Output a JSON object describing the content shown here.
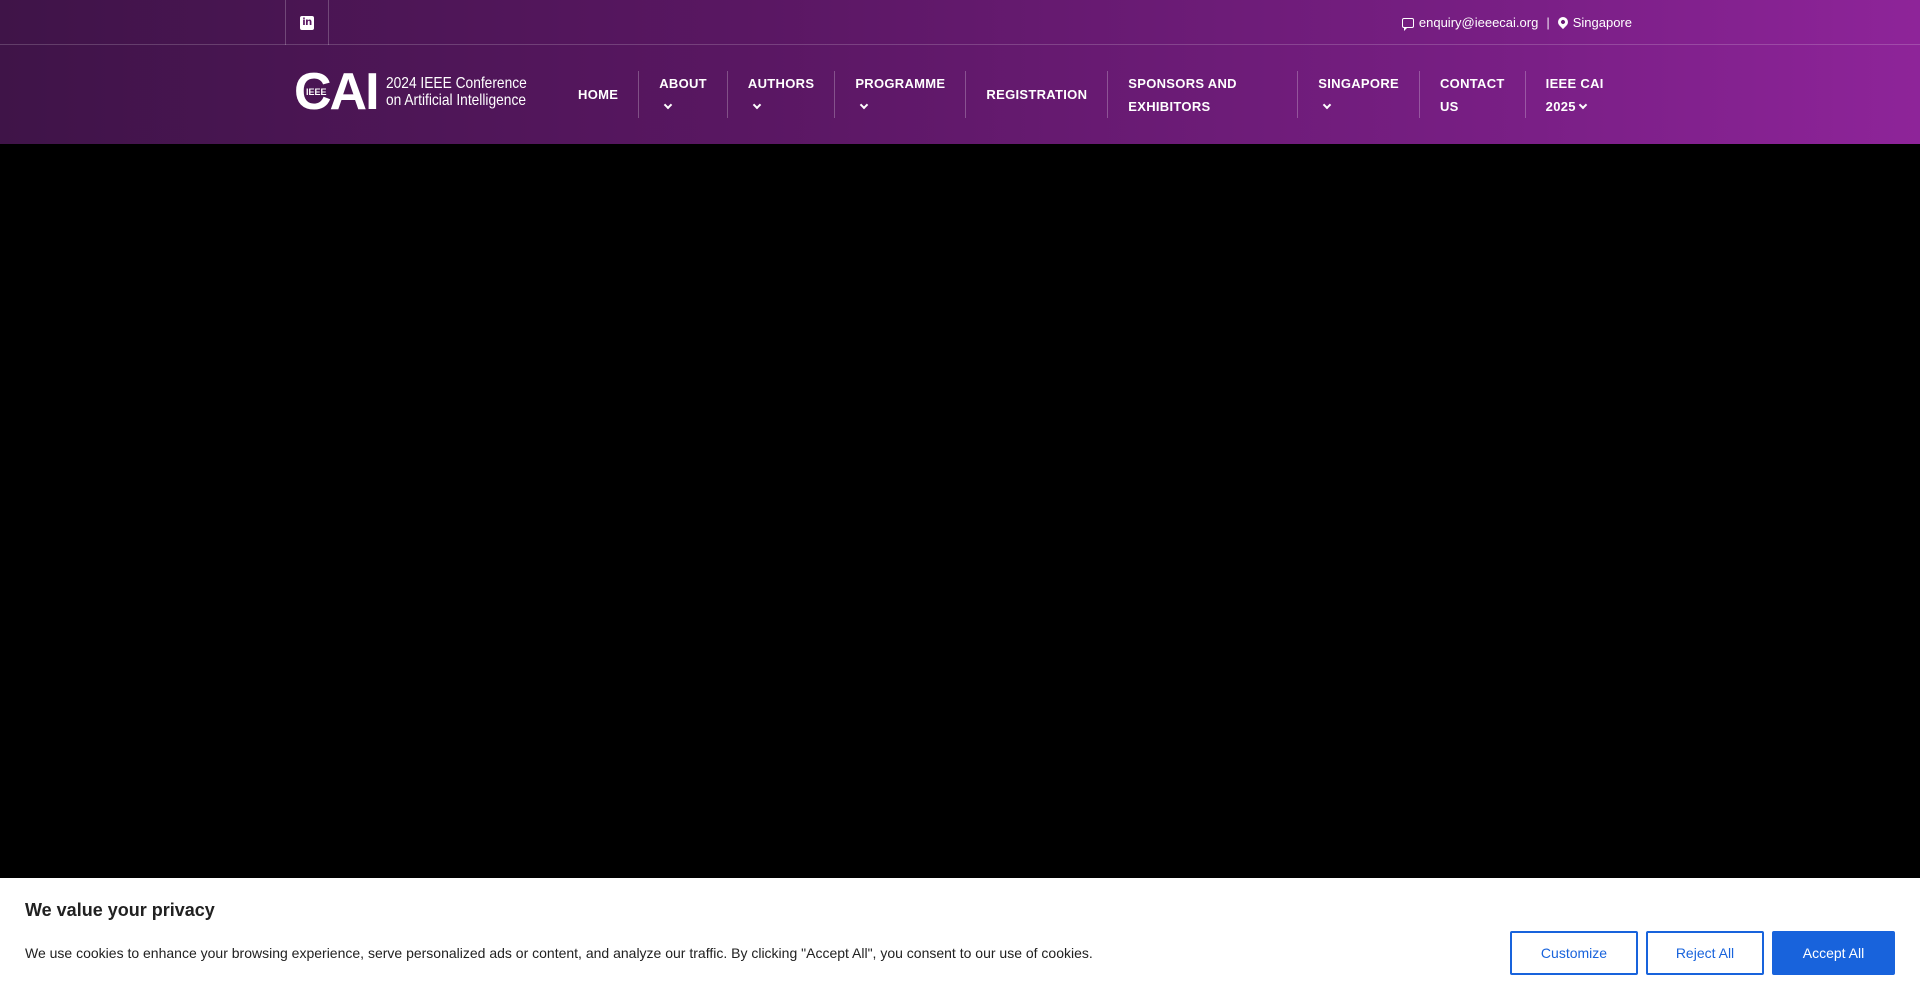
{
  "topbar": {
    "social_icon": "linkedin-icon",
    "email": "enquiry@ieeecai.org",
    "separator": "|",
    "location": "Singapore"
  },
  "logo": {
    "mark": "CAI",
    "mark_small": "IEEE",
    "line1": "2024 IEEE Conference",
    "line2": "on Artificial Intelligence"
  },
  "nav": {
    "home": "HOME",
    "about": "ABOUT",
    "authors": "AUTHORS",
    "programme": "PROGRAMME",
    "registration": "REGISTRATION",
    "sponsors_l1": "SPONSORS AND",
    "sponsors_l2": "EXHIBITORS",
    "singapore": "SINGAPORE",
    "contact_l1": "CONTACT",
    "contact_l2": "US",
    "ieeecai_l1": "IEEE CAI",
    "ieeecai_l2": "2025"
  },
  "cookie_banner": {
    "title": "We value your privacy",
    "text": "We use cookies to enhance your browsing experience, serve personalized ads or content, and analyze our traffic. By clicking \"Accept All\", you consent to our use of cookies.",
    "customize": "Customize",
    "reject": "Reject All",
    "accept": "Accept All"
  },
  "colors": {
    "header_start": "#3f1448",
    "header_end": "#8e2499",
    "button_blue": "#1863dc"
  }
}
